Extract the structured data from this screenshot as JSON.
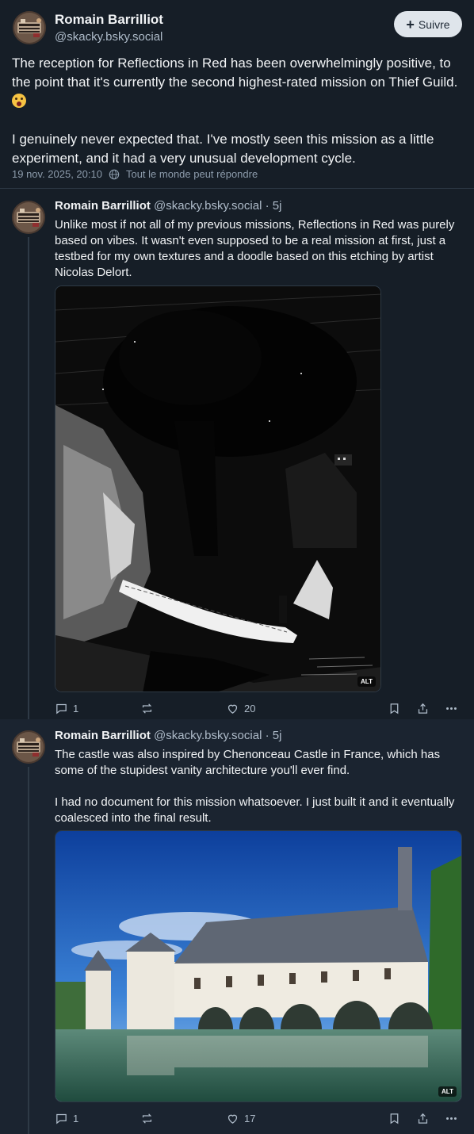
{
  "main_post": {
    "author_name": "Romain Barrilliot",
    "author_handle": "@skacky.bsky.social",
    "follow_label": "Suivre",
    "text_p1": "The reception for Reflections in Red has been overwhelmingly positive, to the point that it's currently the second highest-rated mission on Thief Guild.",
    "emoji_icon": "flushed-face-emoji",
    "text_p2": "I genuinely never expected that. I've mostly seen this mission as a little experiment, and it had a very unusual development cycle.",
    "date": "19 nov. 2025, 20:10",
    "reply_setting": "Tout le monde peut répondre"
  },
  "replies": [
    {
      "author_name": "Romain Barrilliot",
      "author_handle": "@skacky.bsky.social",
      "time": "· 5j",
      "text_p1": "Unlike most if not all of my previous missions, Reflections in Red was purely based on vibes. It wasn't even supposed to be a real mission at first, just a testbed for my own textures and a doodle based on this etching by artist Nicolas Delort.",
      "alt_label": "ALT",
      "reply_count": "1",
      "like_count": "20"
    },
    {
      "author_name": "Romain Barrilliot",
      "author_handle": "@skacky.bsky.social",
      "time": "· 5j",
      "text_p1": "The castle was also inspired by Chenonceau Castle in France, which has some of the stupidest vanity architecture you'll ever find.",
      "text_p2": "I had no document for this mission whatsoever. I just built it and it eventually coalesced into the final result.",
      "alt_label": "ALT",
      "reply_count": "1",
      "like_count": "17"
    }
  ],
  "colors": {
    "background": "#161e27",
    "text": "#f1f3f5",
    "muted": "#aebbc9",
    "border": "#2e3a46",
    "follow_button": "#dfe5eb"
  }
}
